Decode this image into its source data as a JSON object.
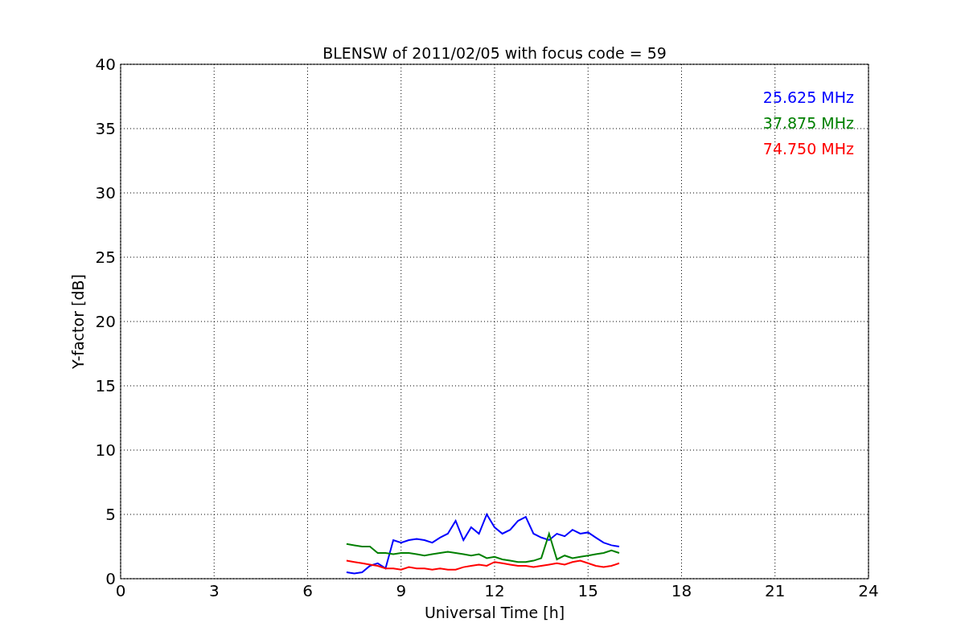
{
  "chart_data": {
    "type": "line",
    "title": "BLENSW of 2011/02/05 with focus code = 59",
    "xlabel": "Universal Time [h]",
    "ylabel": "Y-factor [dB]",
    "x": [
      7.25,
      7.5,
      7.75,
      8,
      8.25,
      8.5,
      8.75,
      9,
      9.25,
      9.5,
      9.75,
      10,
      10.25,
      10.5,
      10.75,
      11,
      11.25,
      11.5,
      11.75,
      12,
      12.25,
      12.5,
      12.75,
      13,
      13.25,
      13.5,
      13.75,
      14,
      14.25,
      14.5,
      14.75,
      15,
      15.25,
      15.5,
      15.75,
      16
    ],
    "series": [
      {
        "name": "25.625 MHz",
        "color": "#0000ff",
        "values": [
          0.5,
          0.4,
          0.5,
          1.0,
          1.2,
          0.8,
          3.0,
          2.8,
          3.0,
          3.1,
          3.0,
          2.8,
          3.2,
          3.5,
          4.5,
          3.0,
          4.0,
          3.5,
          5.0,
          4.0,
          3.5,
          3.8,
          4.5,
          4.8,
          3.5,
          3.2,
          3.0,
          3.5,
          3.3,
          3.8,
          3.5,
          3.6,
          3.2,
          2.8,
          2.6,
          2.5
        ]
      },
      {
        "name": "37.875 MHz",
        "color": "#008000",
        "values": [
          2.7,
          2.6,
          2.5,
          2.5,
          2.0,
          2.0,
          1.9,
          2.0,
          2.0,
          1.9,
          1.8,
          1.9,
          2.0,
          2.1,
          2.0,
          1.9,
          1.8,
          1.9,
          1.6,
          1.7,
          1.5,
          1.4,
          1.3,
          1.3,
          1.4,
          1.6,
          3.5,
          1.5,
          1.8,
          1.6,
          1.7,
          1.8,
          1.9,
          2.0,
          2.2,
          2.0
        ]
      },
      {
        "name": "74.750 MHz",
        "color": "#ff0000",
        "values": [
          1.4,
          1.3,
          1.2,
          1.1,
          1.0,
          0.8,
          0.8,
          0.7,
          0.9,
          0.8,
          0.8,
          0.7,
          0.8,
          0.7,
          0.7,
          0.9,
          1.0,
          1.1,
          1.0,
          1.3,
          1.2,
          1.1,
          1.0,
          1.0,
          0.9,
          1.0,
          1.1,
          1.2,
          1.1,
          1.3,
          1.4,
          1.2,
          1.0,
          0.9,
          1.0,
          1.2
        ]
      }
    ],
    "grid": true,
    "xlim": [
      0,
      24
    ],
    "ylim": [
      0,
      40
    ],
    "xticks": [
      0,
      3,
      6,
      9,
      12,
      15,
      18,
      21,
      24
    ],
    "yticks": [
      0,
      5,
      10,
      15,
      20,
      25,
      30,
      35,
      40
    ]
  }
}
